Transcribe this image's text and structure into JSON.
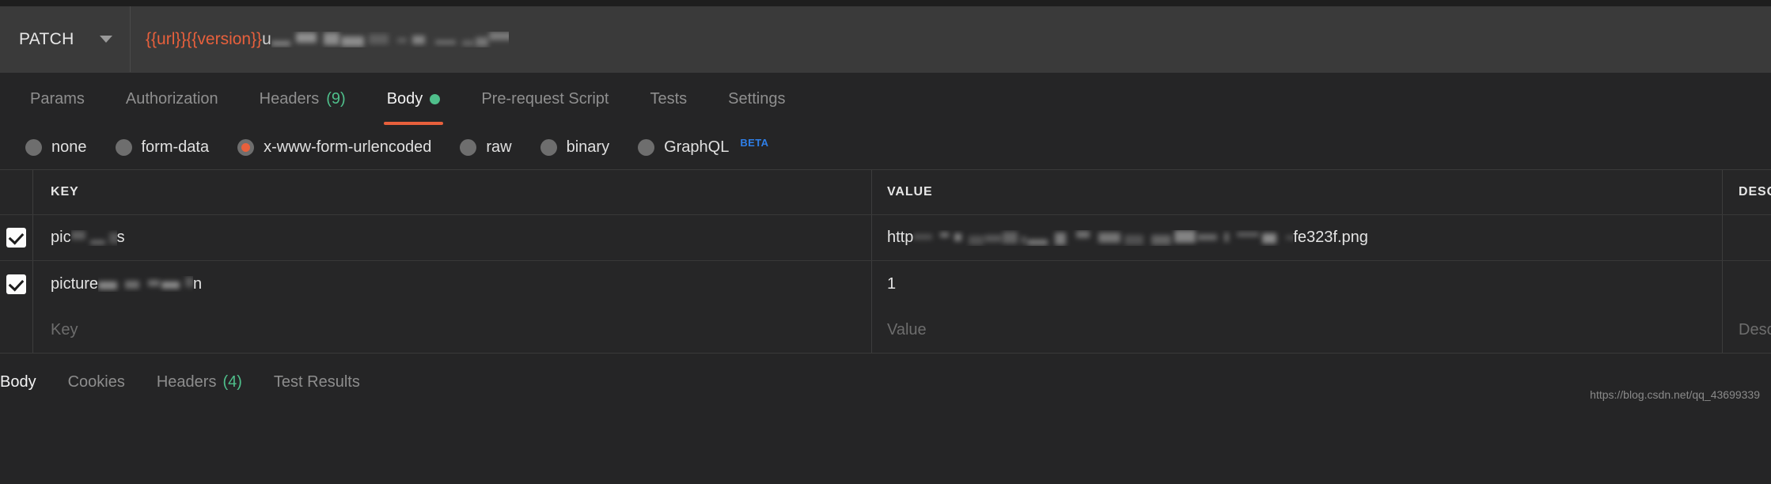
{
  "request_bar": {
    "method": "PATCH",
    "method_caret_icon": "chevron-down-icon",
    "url_variables": "{{url}}{{version}}",
    "url_rest": "u",
    "url_redacted_tail": "ype picture"
  },
  "request_tabs": [
    {
      "label": "Params",
      "active": false,
      "count": "",
      "has_dot": false
    },
    {
      "label": "Authorization",
      "active": false,
      "count": "",
      "has_dot": false
    },
    {
      "label": "Headers",
      "active": false,
      "count": "(9)",
      "has_dot": false
    },
    {
      "label": "Body",
      "active": true,
      "count": "",
      "has_dot": true
    },
    {
      "label": "Pre-request Script",
      "active": false,
      "count": "",
      "has_dot": false
    },
    {
      "label": "Tests",
      "active": false,
      "count": "",
      "has_dot": false
    },
    {
      "label": "Settings",
      "active": false,
      "count": "",
      "has_dot": false
    }
  ],
  "body_types": [
    {
      "label": "none",
      "selected": false,
      "badge": ""
    },
    {
      "label": "form-data",
      "selected": false,
      "badge": ""
    },
    {
      "label": "x-www-form-urlencoded",
      "selected": true,
      "badge": ""
    },
    {
      "label": "raw",
      "selected": false,
      "badge": ""
    },
    {
      "label": "binary",
      "selected": false,
      "badge": ""
    },
    {
      "label": "GraphQL",
      "selected": false,
      "badge": "BETA"
    }
  ],
  "table": {
    "headers": {
      "key": "KEY",
      "value": "VALUE",
      "description": "DESCRIPT"
    },
    "rows": [
      {
        "checked": true,
        "key_prefix": "pic",
        "key_redacted": true,
        "key_suffix": "s",
        "value_prefix": "http",
        "value_redacted": true,
        "value_suffix": "fe323f.png",
        "description": ""
      },
      {
        "checked": true,
        "key_prefix": "picture",
        "key_redacted": true,
        "key_suffix": "n",
        "value_prefix": "1",
        "value_redacted": false,
        "value_suffix": "",
        "description": ""
      }
    ],
    "placeholder_row": {
      "key": "Key",
      "value": "Value",
      "description": "Descrip"
    }
  },
  "response_tabs": [
    {
      "label": "Body",
      "active": true,
      "count": ""
    },
    {
      "label": "Cookies",
      "active": false,
      "count": ""
    },
    {
      "label": "Headers",
      "active": false,
      "count": "(4)"
    },
    {
      "label": "Test Results",
      "active": false,
      "count": ""
    }
  ],
  "watermark": "https://blog.csdn.net/qq_43699339",
  "colors": {
    "accent_orange": "#e8603c",
    "green": "#4fbf8b",
    "beta_blue": "#2f7fe8",
    "background": "#252526",
    "bar_background": "#3a3a3a"
  }
}
